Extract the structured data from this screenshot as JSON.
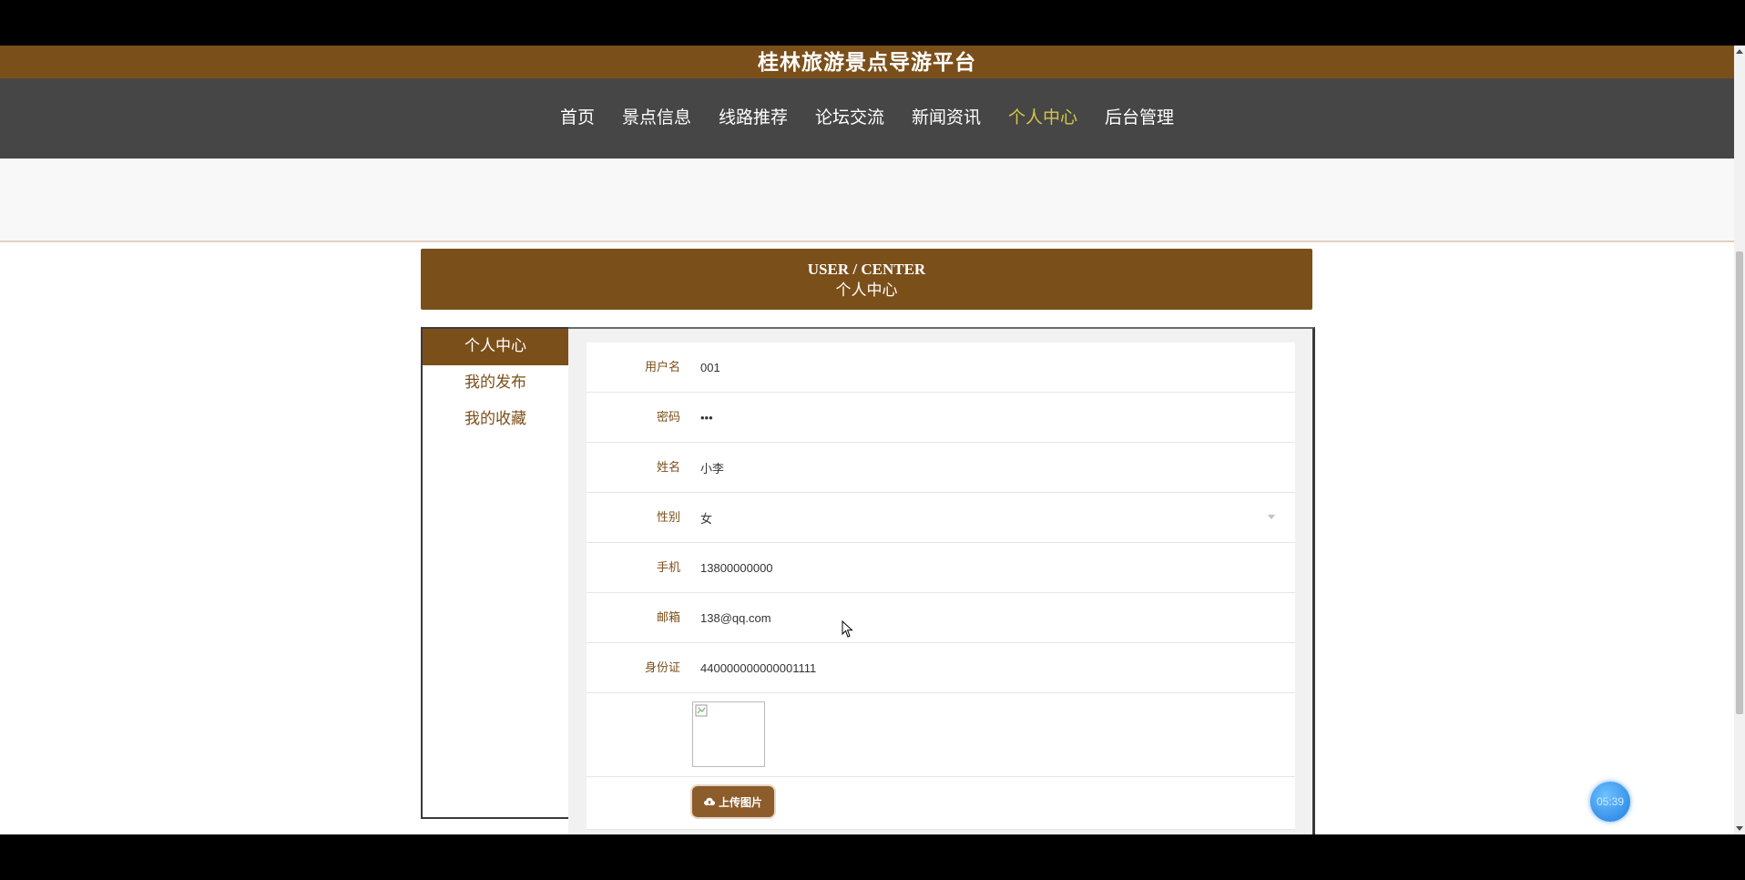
{
  "site": {
    "title": "桂林旅游景点导游平台"
  },
  "nav": {
    "items": [
      {
        "label": "首页"
      },
      {
        "label": "景点信息"
      },
      {
        "label": "线路推荐"
      },
      {
        "label": "论坛交流"
      },
      {
        "label": "新闻资讯"
      },
      {
        "label": "个人中心"
      },
      {
        "label": "后台管理"
      }
    ],
    "active_index": 5
  },
  "section": {
    "title_en": "USER / CENTER",
    "title_cn": "个人中心"
  },
  "sidebar": {
    "items": [
      {
        "label": "个人中心"
      },
      {
        "label": "我的发布"
      },
      {
        "label": "我的收藏"
      }
    ],
    "active_index": 0
  },
  "form": {
    "username": {
      "label": "用户名",
      "value": "001"
    },
    "password": {
      "label": "密码",
      "value": "•••"
    },
    "name": {
      "label": "姓名",
      "value": "小李"
    },
    "gender": {
      "label": "性别",
      "value": "女"
    },
    "phone": {
      "label": "手机",
      "value": "13800000000"
    },
    "email": {
      "label": "邮箱",
      "value": "138@qq.com"
    },
    "idcard": {
      "label": "身份证",
      "value": "440000000000001111"
    },
    "upload_label": "上传图片"
  },
  "badge": {
    "text": "05:39"
  },
  "colors": {
    "brand_brown": "#7b4f1a",
    "nav_bg": "#464646",
    "nav_active": "#d4c64a",
    "upload_button": "#8c5c2b"
  },
  "icons": {
    "upload": "cloud-upload-icon",
    "broken_image": "broken-image-icon",
    "cursor": "mouse-cursor-icon"
  }
}
